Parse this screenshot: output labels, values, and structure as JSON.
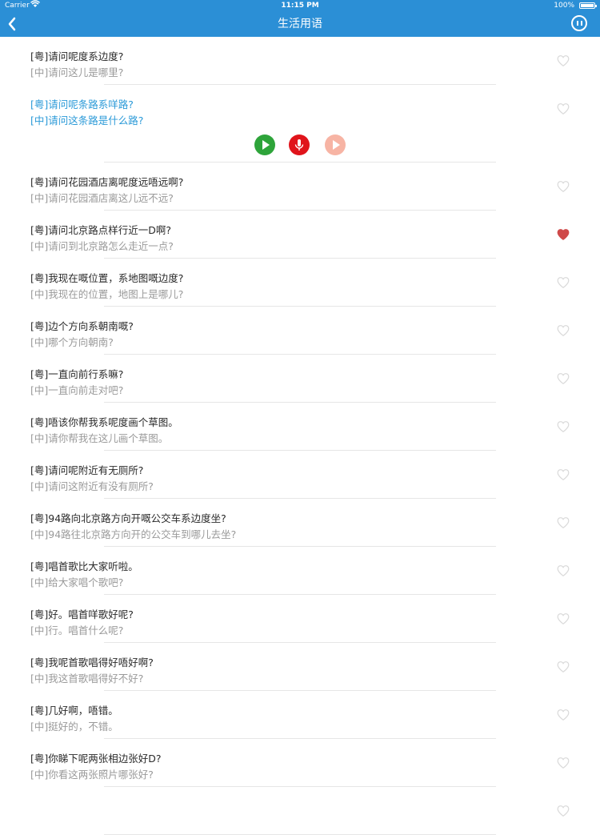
{
  "status_bar": {
    "carrier": "Carrier",
    "time": "11:15 PM",
    "battery": "100%"
  },
  "nav": {
    "title": "生活用语",
    "back_icon": "chevron-left-icon",
    "pause_icon": "pause-circle-icon"
  },
  "colors": {
    "accent": "#2b8fd6",
    "heart_active": "#cf4a4a",
    "heart_inactive": "#d9d9d9"
  },
  "controls": {
    "play_icon": "play-icon",
    "record_icon": "microphone-icon",
    "playback_icon": "playback-icon"
  },
  "items": [
    {
      "yue": "[粤]请问呢度系边度?",
      "zh": "[中]请问这儿是哪里?",
      "favorite": false
    },
    {
      "yue": "[粤]请问呢条路系咩路?",
      "zh": "[中]请问这条路是什么路?",
      "favorite": false,
      "expanded": true
    },
    {
      "yue": "[粤]请问花园酒店离呢度远唔远啊?",
      "zh": "[中]请问花园酒店离这儿远不远?",
      "favorite": false
    },
    {
      "yue": "[粤]请问北京路点样行近一D啊?",
      "zh": "[中]请问到北京路怎么走近一点?",
      "favorite": true
    },
    {
      "yue": "[粤]我现在嘅位置，系地图嘅边度?",
      "zh": "[中]我现在的位置，地图上是哪儿?",
      "favorite": false
    },
    {
      "yue": "[粤]边个方向系朝南嘅?",
      "zh": "[中]哪个方向朝南?",
      "favorite": false
    },
    {
      "yue": "[粤]一直向前行系嘛?",
      "zh": "[中]一直向前走对吧?",
      "favorite": false
    },
    {
      "yue": "[粤]唔该你帮我系呢度画个草图。",
      "zh": "[中]请你帮我在这儿画个草图。",
      "favorite": false
    },
    {
      "yue": "[粤]请问呢附近有无厕所?",
      "zh": "[中]请问这附近有没有厕所?",
      "favorite": false
    },
    {
      "yue": "[粤]94路向北京路方向开嘅公交车系边度坐?",
      "zh": "[中]94路往北京路方向开的公交车到哪儿去坐?",
      "favorite": false
    },
    {
      "yue": "[粤]唱首歌比大家听啦。",
      "zh": "[中]给大家唱个歌吧?",
      "favorite": false
    },
    {
      "yue": "[粤]好。唱首咩歌好呢?",
      "zh": "[中]行。唱首什么呢?",
      "favorite": false
    },
    {
      "yue": "[粤]我呢首歌唱得好唔好啊?",
      "zh": "[中]我这首歌唱得好不好?",
      "favorite": false
    },
    {
      "yue": "[粤]几好啊，唔错。",
      "zh": "[中]挺好的，不错。",
      "favorite": false
    },
    {
      "yue": "[粤]你睇下呢两张相边张好D?",
      "zh": "[中]你看这两张照片哪张好?",
      "favorite": false
    },
    {
      "yue": "",
      "zh": "",
      "favorite": false
    }
  ]
}
